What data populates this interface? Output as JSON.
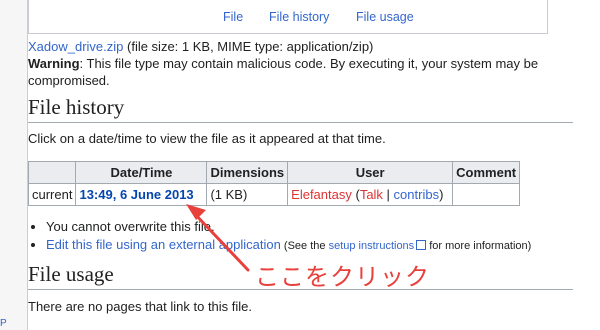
{
  "tabs": {
    "file": "File",
    "history": "File history",
    "usage": "File usage"
  },
  "fileinfo": {
    "filename": "Xadow_drive.zip",
    "details": " (file size: 1 KB, MIME type: application/zip)"
  },
  "warning": {
    "label": "Warning",
    "text": ": This file type may contain malicious code. By executing it, your system may be compromised."
  },
  "history": {
    "heading": "File history",
    "instructions": "Click on a date/time to view the file as it appeared at that time.",
    "columns": [
      "",
      "Date/Time",
      "Dimensions",
      "User",
      "Comment"
    ],
    "row": {
      "status": "current",
      "datetime": "13:49, 6 June 2013",
      "dimensions": "(1 KB)",
      "user": "Elefantasy",
      "talk": "Talk",
      "contribs": "contribs",
      "comment": ""
    }
  },
  "bullets": {
    "overwrite": "You cannot overwrite this file.",
    "edit_link": "Edit this file using an external application",
    "see_prefix": " (See the ",
    "setup_link": "setup instructions",
    "see_suffix": " for more information)"
  },
  "usage": {
    "heading": "File usage",
    "text": "There are no pages that link to this file."
  },
  "annotation": {
    "text": "ここをクリック",
    "color": "#e8413b"
  },
  "edge": {
    "glyph": "P"
  }
}
